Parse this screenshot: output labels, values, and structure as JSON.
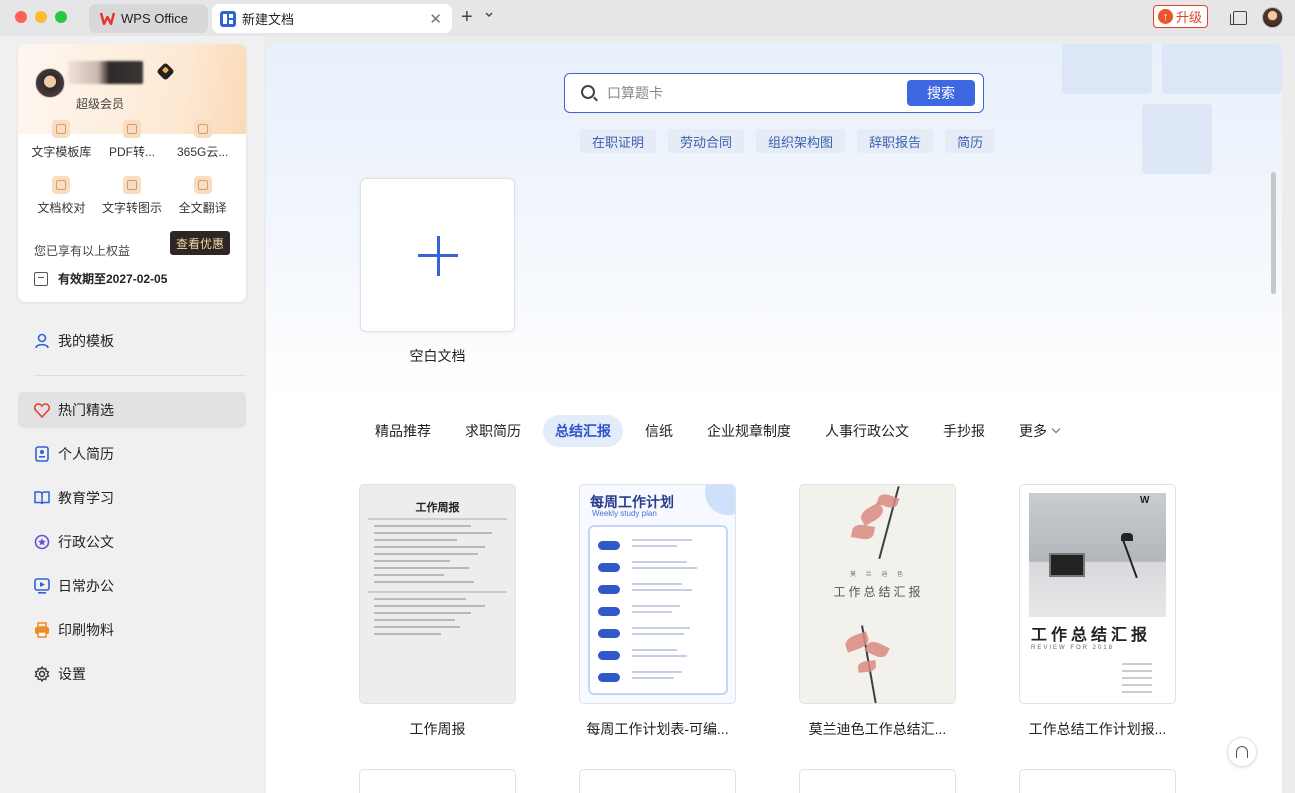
{
  "titlebar": {
    "wps_tab": "WPS Office",
    "doc_tab": "新建文档",
    "upgrade": "升级"
  },
  "sidebar": {
    "member": {
      "type": "超级会员",
      "perks": [
        "文字模板库",
        "PDF转...",
        "365G云...",
        "文档校对",
        "文字转图示",
        "全文翻译"
      ],
      "note": "您已享有以上权益",
      "view_button": "查看优惠",
      "expiry": "有效期至2027-02-05"
    },
    "my_templates": "我的模板",
    "items": [
      "热门精选",
      "个人简历",
      "教育学习",
      "行政公文",
      "日常办公",
      "印刷物料",
      "设置"
    ]
  },
  "main": {
    "search": {
      "placeholder": "口算题卡",
      "button": "搜索"
    },
    "chips": [
      "在职证明",
      "劳动合同",
      "组织架构图",
      "辞职报告",
      "简历"
    ],
    "blank_doc": "空白文档",
    "categories": [
      "精品推荐",
      "求职简历",
      "总结汇报",
      "信纸",
      "企业规章制度",
      "人事行政公文",
      "手抄报",
      "更多"
    ],
    "active_category": "总结汇报",
    "templates": [
      {
        "label": "工作周报",
        "thumb_title": "工作周报"
      },
      {
        "label": "每周工作计划表-可编...",
        "thumb_title": "每周工作计划",
        "thumb_sub": "Weekly study plan"
      },
      {
        "label": "莫兰迪色工作总结汇...",
        "thumb_title": "工作总结汇报",
        "thumb_sub": "莫 兰 迪 色"
      },
      {
        "label": "工作总结工作计划报...",
        "thumb_title": "工作总结汇报",
        "thumb_sub": "REVIEW FOR 2018"
      }
    ]
  },
  "colors": {
    "accent": "#3e67e2",
    "upgrade": "#e0412c",
    "vip_button_bg": "#2d2622"
  }
}
